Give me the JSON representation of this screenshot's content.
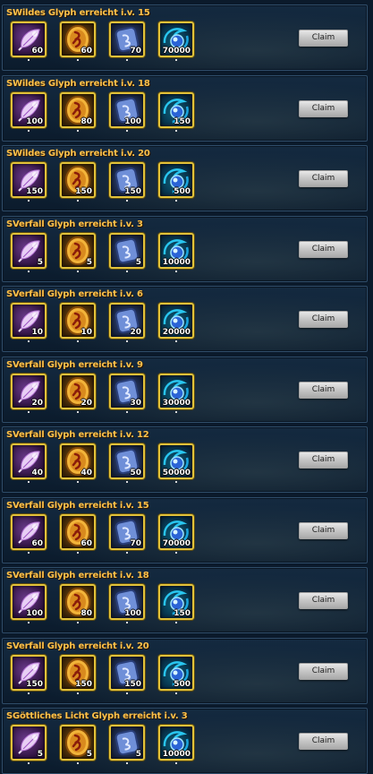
{
  "claim_label": "Claim",
  "rows": [
    {
      "title": "SWildes Glyph erreicht i.v. 15",
      "quantities": [
        "60",
        "60",
        "70",
        "70000"
      ]
    },
    {
      "title": "SWildes Glyph erreicht i.v. 18",
      "quantities": [
        "100",
        "80",
        "100",
        "150"
      ]
    },
    {
      "title": "SWildes Glyph erreicht i.v. 20",
      "quantities": [
        "150",
        "150",
        "150",
        "500"
      ]
    },
    {
      "title": "SVerfall Glyph erreicht i.v. 3",
      "quantities": [
        "5",
        "5",
        "5",
        "10000"
      ]
    },
    {
      "title": "SVerfall Glyph erreicht i.v. 6",
      "quantities": [
        "10",
        "10",
        "20",
        "20000"
      ]
    },
    {
      "title": "SVerfall Glyph erreicht i.v. 9",
      "quantities": [
        "20",
        "20",
        "30",
        "30000"
      ]
    },
    {
      "title": "SVerfall Glyph erreicht i.v. 12",
      "quantities": [
        "40",
        "40",
        "50",
        "50000"
      ]
    },
    {
      "title": "SVerfall Glyph erreicht i.v. 15",
      "quantities": [
        "60",
        "60",
        "70",
        "70000"
      ]
    },
    {
      "title": "SVerfall Glyph erreicht i.v. 18",
      "quantities": [
        "100",
        "80",
        "100",
        "150"
      ]
    },
    {
      "title": "SVerfall Glyph erreicht i.v. 20",
      "quantities": [
        "150",
        "150",
        "150",
        "500"
      ]
    },
    {
      "title": "SGöttliches Licht Glyph erreicht i.v. 3",
      "quantities": [
        "5",
        "5",
        "5",
        "10000"
      ]
    }
  ],
  "item_icons": [
    "feather-icon",
    "rune-icon",
    "scroll-icon",
    "orb-icon"
  ],
  "colors": {
    "title": "#ffc24a",
    "frame": "#e2c23a",
    "panel": "#0f2236"
  }
}
